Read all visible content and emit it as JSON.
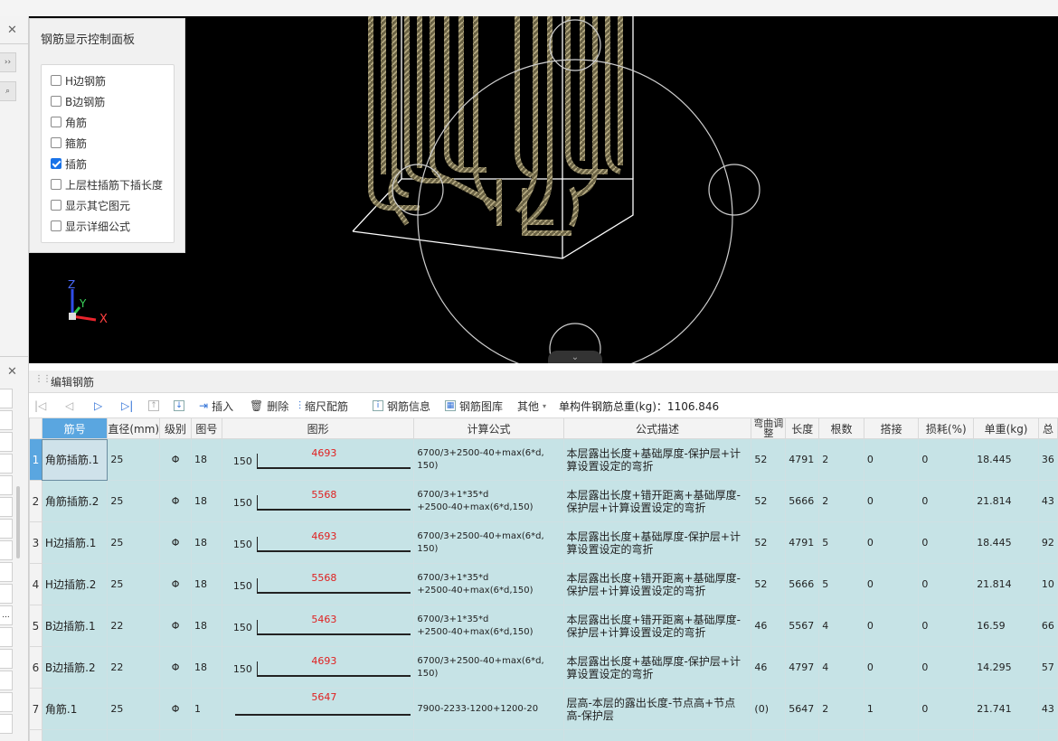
{
  "leftpane": {
    "close_top": "✕",
    "close_mid": "✕",
    "more": "››",
    "search": "⌕",
    "ellipsis": "..."
  },
  "control_panel": {
    "title": "钢筋显示控制面板",
    "options": [
      {
        "label": "H边钢筋",
        "checked": false
      },
      {
        "label": "B边钢筋",
        "checked": false
      },
      {
        "label": "角筋",
        "checked": false
      },
      {
        "label": "箍筋",
        "checked": false
      },
      {
        "label": "插筋",
        "checked": true
      },
      {
        "label": "上层柱插筋下插长度",
        "checked": false
      },
      {
        "label": "显示其它图元",
        "checked": false
      },
      {
        "label": "显示详细公式",
        "checked": false
      }
    ]
  },
  "axes": {
    "z": "Z",
    "y": "Y",
    "x": "X"
  },
  "edit_panel": {
    "title": "编辑钢筋"
  },
  "toolbar": {
    "insert": "插入",
    "delete": "删除",
    "scale_rebar": "缩尺配筋",
    "rebar_info": "钢筋信息",
    "rebar_library": "钢筋图库",
    "other": "其他",
    "total_label": "单构件钢筋总重(kg)：1106.846"
  },
  "table": {
    "headers": [
      "筋号",
      "直径(mm)",
      "级别",
      "图号",
      "图形",
      "计算公式",
      "公式描述",
      "弯曲调整",
      "长度",
      "根数",
      "搭接",
      "损耗(%)",
      "单重(kg)",
      "总"
    ],
    "rows": [
      {
        "num": "1",
        "name": "角筋插筋.1",
        "dia": "25",
        "grade": "Φ",
        "fig": "18",
        "left": "150",
        "shape_val": "4693",
        "formula": "6700/3+2500-40+max(6*d,\n150)",
        "desc": "本层露出长度+基础厚度-保护层+计算设置设定的弯折",
        "bend": "52",
        "len": "4791",
        "count": "2",
        "lap": "0",
        "loss": "0",
        "unit": "18.445",
        "total": "36"
      },
      {
        "num": "2",
        "name": "角筋插筋.2",
        "dia": "25",
        "grade": "Φ",
        "fig": "18",
        "left": "150",
        "shape_val": "5568",
        "formula": "6700/3+1*35*d\n+2500-40+max(6*d,150)",
        "desc": "本层露出长度+错开距离+基础厚度-保护层+计算设置设定的弯折",
        "bend": "52",
        "len": "5666",
        "count": "2",
        "lap": "0",
        "loss": "0",
        "unit": "21.814",
        "total": "43"
      },
      {
        "num": "3",
        "name": "H边插筋.1",
        "dia": "25",
        "grade": "Φ",
        "fig": "18",
        "left": "150",
        "shape_val": "4693",
        "formula": "6700/3+2500-40+max(6*d,\n150)",
        "desc": "本层露出长度+基础厚度-保护层+计算设置设定的弯折",
        "bend": "52",
        "len": "4791",
        "count": "5",
        "lap": "0",
        "loss": "0",
        "unit": "18.445",
        "total": "92"
      },
      {
        "num": "4",
        "name": "H边插筋.2",
        "dia": "25",
        "grade": "Φ",
        "fig": "18",
        "left": "150",
        "shape_val": "5568",
        "formula": "6700/3+1*35*d\n+2500-40+max(6*d,150)",
        "desc": "本层露出长度+错开距离+基础厚度-保护层+计算设置设定的弯折",
        "bend": "52",
        "len": "5666",
        "count": "5",
        "lap": "0",
        "loss": "0",
        "unit": "21.814",
        "total": "10"
      },
      {
        "num": "5",
        "name": "B边插筋.1",
        "dia": "22",
        "grade": "Φ",
        "fig": "18",
        "left": "150",
        "shape_val": "5463",
        "formula": "6700/3+1*35*d\n+2500-40+max(6*d,150)",
        "desc": "本层露出长度+错开距离+基础厚度-保护层+计算设置设定的弯折",
        "bend": "46",
        "len": "5567",
        "count": "4",
        "lap": "0",
        "loss": "0",
        "unit": "16.59",
        "total": "66"
      },
      {
        "num": "6",
        "name": "B边插筋.2",
        "dia": "22",
        "grade": "Φ",
        "fig": "18",
        "left": "150",
        "shape_val": "4693",
        "formula": "6700/3+2500-40+max(6*d,\n150)",
        "desc": "本层露出长度+基础厚度-保护层+计算设置设定的弯折",
        "bend": "46",
        "len": "4797",
        "count": "4",
        "lap": "0",
        "loss": "0",
        "unit": "14.295",
        "total": "57"
      },
      {
        "num": "7",
        "name": "角筋.1",
        "dia": "25",
        "grade": "Φ",
        "fig": "1",
        "left": "",
        "shape_val": "5647",
        "formula": "7900-2233-1200+1200-20",
        "desc": "层高-本层的露出长度-节点高+节点高-保护层",
        "bend": "(0)",
        "len": "5647",
        "count": "2",
        "lap": "1",
        "loss": "0",
        "unit": "21.741",
        "total": "43"
      },
      {
        "num": "",
        "name": "",
        "dia": "",
        "grade": "",
        "fig": "",
        "left": "",
        "shape_val": "",
        "formula": "",
        "desc": "层高-本层的露出长度-节点高+节点",
        "bend": "",
        "len": "",
        "count": "",
        "lap": "",
        "loss": "",
        "unit": "",
        "total": ""
      }
    ]
  }
}
